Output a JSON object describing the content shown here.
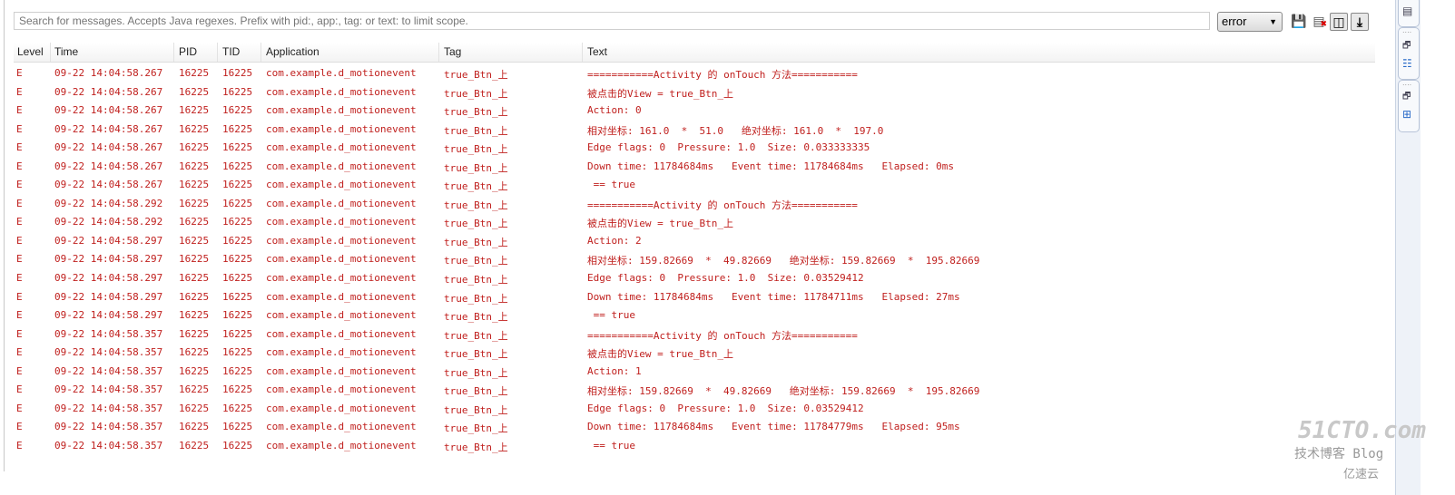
{
  "search": {
    "placeholder": "Search for messages. Accepts Java regexes. Prefix with pid:, app:, tag: or text: to limit scope."
  },
  "level_filter": {
    "selected": "error"
  },
  "toolbar": {
    "icons": [
      "save-icon",
      "clear-log-icon",
      "toggle-panel-icon",
      "scroll-lock-icon"
    ]
  },
  "columns": [
    "Level",
    "Time",
    "PID",
    "TID",
    "Application",
    "Tag",
    "Text"
  ],
  "colors": {
    "error_text": "#c0201e"
  },
  "rows": [
    [
      "E",
      "09-22 14:04:58.267",
      "16225",
      "16225",
      "com.example.d_motionevent",
      "true_Btn_上",
      "===========Activity 的 onTouch 方法==========="
    ],
    [
      "E",
      "09-22 14:04:58.267",
      "16225",
      "16225",
      "com.example.d_motionevent",
      "true_Btn_上",
      "被点击的View = true_Btn_上"
    ],
    [
      "E",
      "09-22 14:04:58.267",
      "16225",
      "16225",
      "com.example.d_motionevent",
      "true_Btn_上",
      "Action: 0"
    ],
    [
      "E",
      "09-22 14:04:58.267",
      "16225",
      "16225",
      "com.example.d_motionevent",
      "true_Btn_上",
      "相对坐标: 161.0  *  51.0   绝对坐标: 161.0  *  197.0"
    ],
    [
      "E",
      "09-22 14:04:58.267",
      "16225",
      "16225",
      "com.example.d_motionevent",
      "true_Btn_上",
      "Edge flags: 0  Pressure: 1.0  Size: 0.033333335"
    ],
    [
      "E",
      "09-22 14:04:58.267",
      "16225",
      "16225",
      "com.example.d_motionevent",
      "true_Btn_上",
      "Down time: 11784684ms   Event time: 11784684ms   Elapsed: 0ms"
    ],
    [
      "E",
      "09-22 14:04:58.267",
      "16225",
      "16225",
      "com.example.d_motionevent",
      "true_Btn_上",
      " == true"
    ],
    [
      "E",
      "09-22 14:04:58.292",
      "16225",
      "16225",
      "com.example.d_motionevent",
      "true_Btn_上",
      "===========Activity 的 onTouch 方法==========="
    ],
    [
      "E",
      "09-22 14:04:58.292",
      "16225",
      "16225",
      "com.example.d_motionevent",
      "true_Btn_上",
      "被点击的View = true_Btn_上"
    ],
    [
      "E",
      "09-22 14:04:58.297",
      "16225",
      "16225",
      "com.example.d_motionevent",
      "true_Btn_上",
      "Action: 2"
    ],
    [
      "E",
      "09-22 14:04:58.297",
      "16225",
      "16225",
      "com.example.d_motionevent",
      "true_Btn_上",
      "相对坐标: 159.82669  *  49.82669   绝对坐标: 159.82669  *  195.82669"
    ],
    [
      "E",
      "09-22 14:04:58.297",
      "16225",
      "16225",
      "com.example.d_motionevent",
      "true_Btn_上",
      "Edge flags: 0  Pressure: 1.0  Size: 0.03529412"
    ],
    [
      "E",
      "09-22 14:04:58.297",
      "16225",
      "16225",
      "com.example.d_motionevent",
      "true_Btn_上",
      "Down time: 11784684ms   Event time: 11784711ms   Elapsed: 27ms"
    ],
    [
      "E",
      "09-22 14:04:58.297",
      "16225",
      "16225",
      "com.example.d_motionevent",
      "true_Btn_上",
      " == true"
    ],
    [
      "E",
      "09-22 14:04:58.357",
      "16225",
      "16225",
      "com.example.d_motionevent",
      "true_Btn_上",
      "===========Activity 的 onTouch 方法==========="
    ],
    [
      "E",
      "09-22 14:04:58.357",
      "16225",
      "16225",
      "com.example.d_motionevent",
      "true_Btn_上",
      "被点击的View = true_Btn_上"
    ],
    [
      "E",
      "09-22 14:04:58.357",
      "16225",
      "16225",
      "com.example.d_motionevent",
      "true_Btn_上",
      "Action: 1"
    ],
    [
      "E",
      "09-22 14:04:58.357",
      "16225",
      "16225",
      "com.example.d_motionevent",
      "true_Btn_上",
      "相对坐标: 159.82669  *  49.82669   绝对坐标: 159.82669  *  195.82669"
    ],
    [
      "E",
      "09-22 14:04:58.357",
      "16225",
      "16225",
      "com.example.d_motionevent",
      "true_Btn_上",
      "Edge flags: 0  Pressure: 1.0  Size: 0.03529412"
    ],
    [
      "E",
      "09-22 14:04:58.357",
      "16225",
      "16225",
      "com.example.d_motionevent",
      "true_Btn_上",
      "Down time: 11784684ms   Event time: 11784779ms   Elapsed: 95ms"
    ],
    [
      "E",
      "09-22 14:04:58.357",
      "16225",
      "16225",
      "com.example.d_motionevent",
      "true_Btn_上",
      " == true"
    ]
  ],
  "watermark": {
    "line1": "51CTO.com",
    "line2": "技术博客  Blog",
    "line3": "亿速云"
  }
}
